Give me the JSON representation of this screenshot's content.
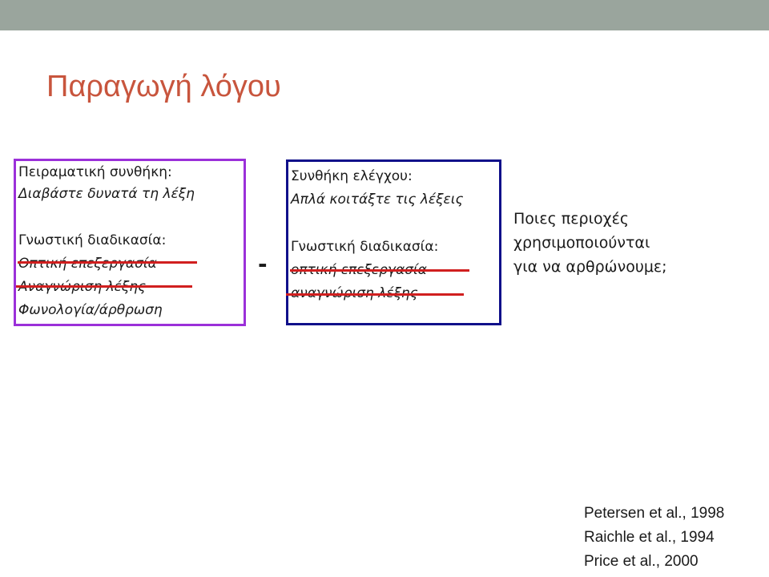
{
  "slide": {
    "title": "Παραγωγή λόγου",
    "colors": {
      "top_band": "#9aa59d",
      "title": "#c8553d",
      "experimental_border": "#9b30d9",
      "control_border": "#10108a",
      "strike": "#d11f1f"
    }
  },
  "experimental": {
    "heading": "Πειραματική συνθήκη:",
    "instruction": "Διαβάστε δυνατά τη λέξη",
    "process_heading": "Γνωστική διαδικασία:",
    "processes": [
      "Οπτική επεξεργασία",
      "Αναγνώριση λέξης",
      "Φωνολογία/άρθρωση"
    ]
  },
  "operator": "-",
  "control": {
    "heading": "Συνθήκη ελέγχου:",
    "instruction": "Απλά κοιτάξτε τις λέξεις",
    "process_heading": "Γνωστική διαδικασία:",
    "processes": [
      "οπτική επεξεργασία",
      "αναγνώριση λέξης"
    ]
  },
  "question": {
    "lines": [
      "Ποιες περιοχές",
      "χρησιμοποιούνται",
      "για να αρθρώνουμε;"
    ]
  },
  "references": [
    "Petersen et al., 1998",
    "Raichle et al., 1994",
    "Price et al., 2000"
  ]
}
